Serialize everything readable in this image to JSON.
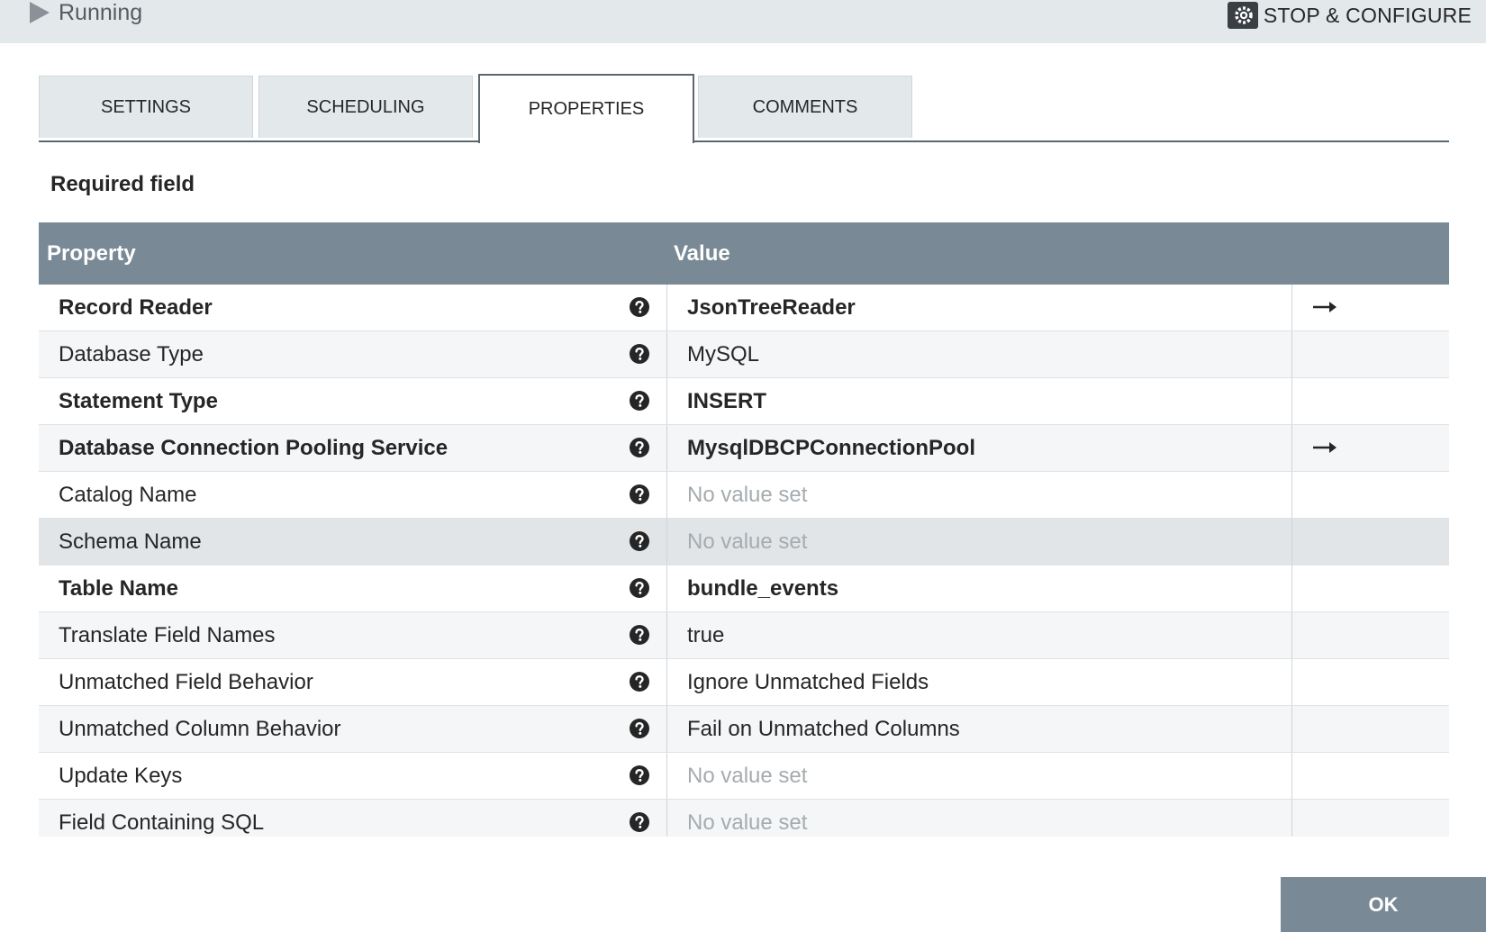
{
  "status": {
    "label": "Running",
    "icon": "play-icon"
  },
  "header": {
    "stop_configure_label": "STOP & CONFIGURE",
    "icon": "gear-icon"
  },
  "tabs": [
    {
      "label": "SETTINGS",
      "active": false
    },
    {
      "label": "SCHEDULING",
      "active": false
    },
    {
      "label": "PROPERTIES",
      "active": true
    },
    {
      "label": "COMMENTS",
      "active": false
    }
  ],
  "required_label": "Required field",
  "table": {
    "columns": {
      "property": "Property",
      "value": "Value"
    },
    "rows": [
      {
        "name": "Record Reader",
        "value": "JsonTreeReader",
        "required": true,
        "empty": false,
        "goto": true
      },
      {
        "name": "Database Type",
        "value": "MySQL",
        "required": false,
        "empty": false,
        "goto": false
      },
      {
        "name": "Statement Type",
        "value": "INSERT",
        "required": true,
        "empty": false,
        "goto": false
      },
      {
        "name": "Database Connection Pooling Service",
        "value": "MysqlDBCPConnectionPool",
        "required": true,
        "empty": false,
        "goto": true
      },
      {
        "name": "Catalog Name",
        "value": "No value set",
        "required": false,
        "empty": true,
        "goto": false
      },
      {
        "name": "Schema Name",
        "value": "No value set",
        "required": false,
        "empty": true,
        "goto": false,
        "selected": true
      },
      {
        "name": "Table Name",
        "value": "bundle_events",
        "required": true,
        "empty": false,
        "goto": false
      },
      {
        "name": "Translate Field Names",
        "value": "true",
        "required": false,
        "empty": false,
        "goto": false
      },
      {
        "name": "Unmatched Field Behavior",
        "value": "Ignore Unmatched Fields",
        "required": false,
        "empty": false,
        "goto": false
      },
      {
        "name": "Unmatched Column Behavior",
        "value": "Fail on Unmatched Columns",
        "required": false,
        "empty": false,
        "goto": false
      },
      {
        "name": "Update Keys",
        "value": "No value set",
        "required": false,
        "empty": true,
        "goto": false
      },
      {
        "name": "Field Containing SQL",
        "value": "No value set",
        "required": false,
        "empty": true,
        "goto": false
      }
    ]
  },
  "ok_label": "OK",
  "colors": {
    "header_bg": "#798a96",
    "topbar_bg": "#e3e8eb",
    "accent_border": "#5b6770"
  }
}
